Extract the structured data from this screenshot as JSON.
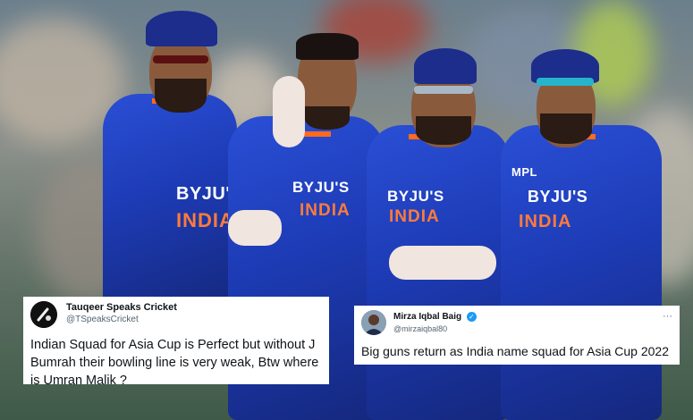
{
  "tweets": [
    {
      "name": "Tauqeer Speaks Cricket",
      "handle": "@TSpeaksCricket",
      "text": "Indian Squad for Asia Cup is Perfect but without J Bumrah their bowling line is very weak, Btw where is Umran Malik ?"
    },
    {
      "name": "Mirza Iqbal Baig",
      "handle": "@mirzaiqbal80",
      "more": "···",
      "text": "Big guns return as India name squad for Asia Cup 2022"
    }
  ],
  "jersey": {
    "sponsor": "BYJU'S",
    "country": "INDIA",
    "sleeve_text": "MPL"
  },
  "colors": {
    "jersey_blue": "#1f3fc4",
    "accent_orange": "#ff6a1c",
    "twitter_blue": "#1d9bf0"
  },
  "icons": [
    "verified-badge-icon",
    "more-options-icon",
    "avatar"
  ]
}
